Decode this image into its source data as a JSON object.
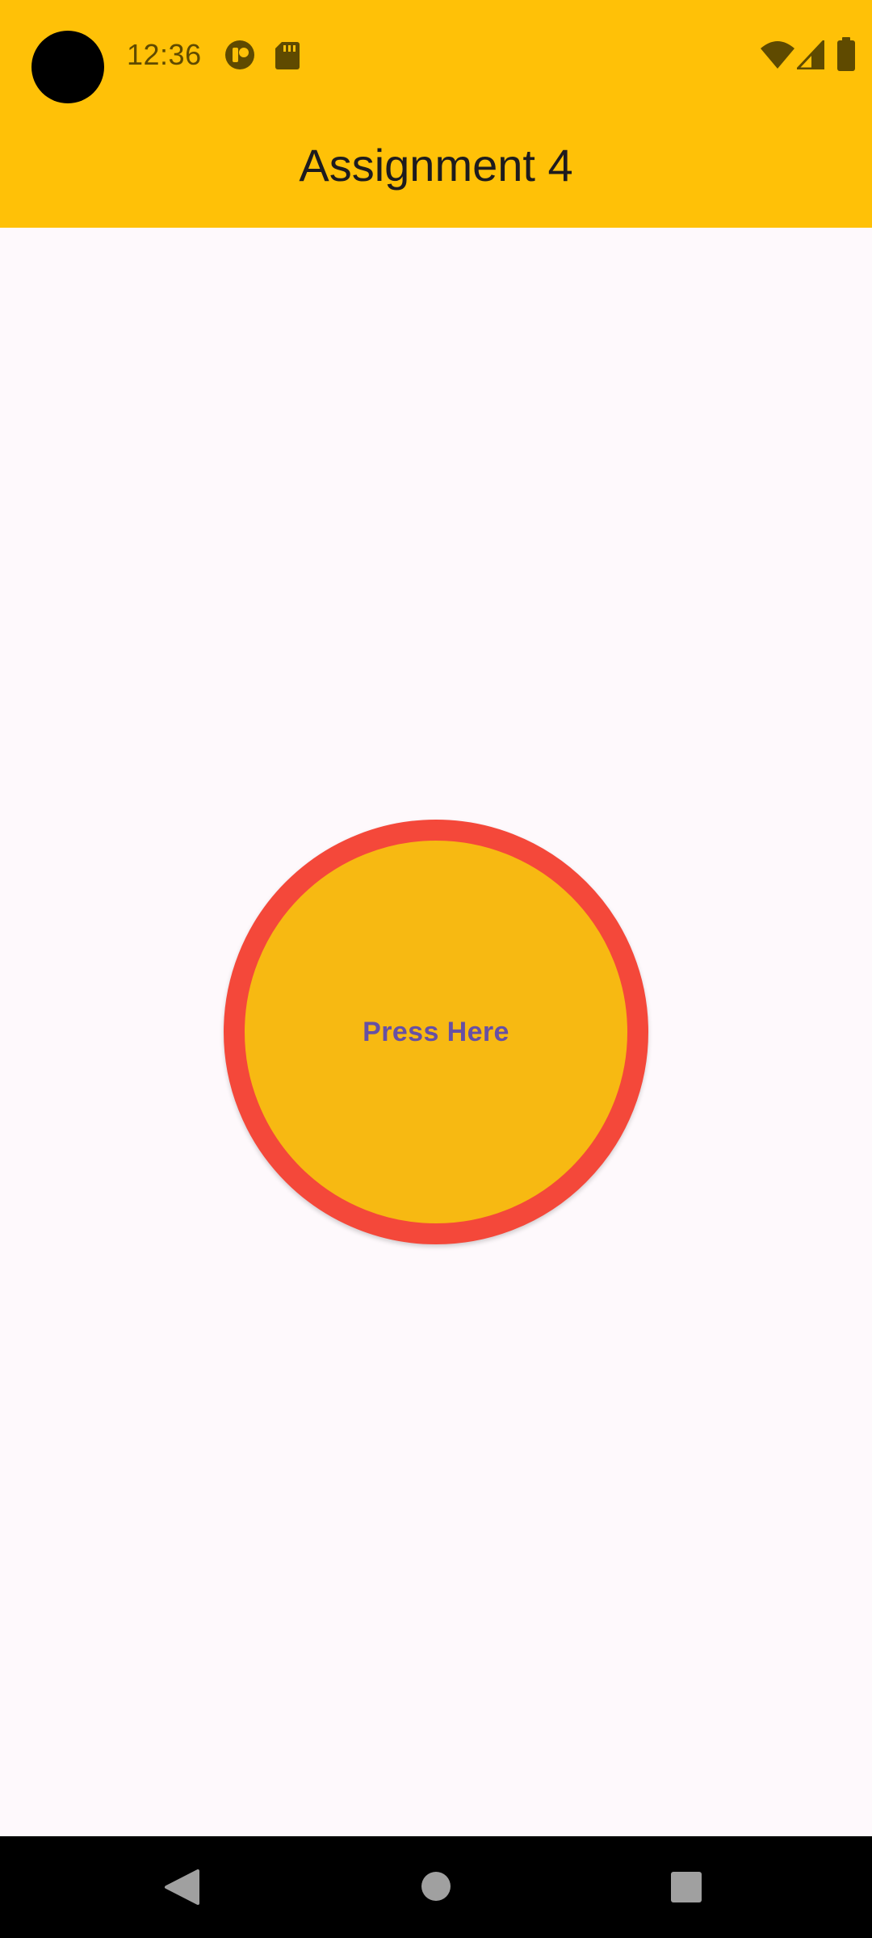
{
  "status_bar": {
    "time": "12:36",
    "left_icons": [
      "camera-cutout",
      "vpn-status-icon",
      "sd-card-icon"
    ],
    "right_icons": [
      "wifi-icon",
      "cellular-signal-icon",
      "battery-icon"
    ],
    "icon_color": "#5F4A00"
  },
  "app_bar": {
    "title": "Assignment 4",
    "background": "#FFC107"
  },
  "main": {
    "button_label": "Press Here",
    "button_fill": "#F7B912",
    "button_border": "#F4483A",
    "label_color": "#6750A4"
  },
  "nav_bar": {
    "buttons": [
      "back-icon",
      "home-icon",
      "recents-icon"
    ]
  }
}
